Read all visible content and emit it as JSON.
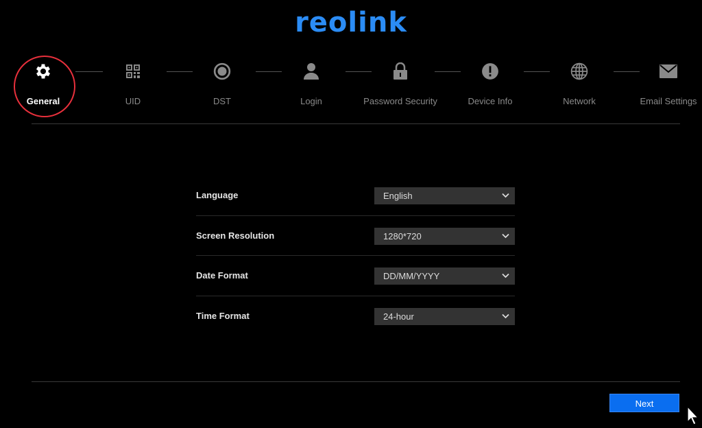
{
  "brand": {
    "logo_text": "reolink",
    "color": "#2b8cf5"
  },
  "steps": [
    {
      "label": "General",
      "icon": "gear-icon",
      "active": true
    },
    {
      "label": "UID",
      "icon": "qr-code-icon",
      "active": false
    },
    {
      "label": "DST",
      "icon": "clock-icon",
      "active": false
    },
    {
      "label": "Login",
      "icon": "user-icon",
      "active": false
    },
    {
      "label": "Password Security",
      "icon": "lock-icon",
      "active": false
    },
    {
      "label": "Device Info",
      "icon": "info-alert-icon",
      "active": false
    },
    {
      "label": "Network",
      "icon": "globe-icon",
      "active": false
    },
    {
      "label": "Email Settings",
      "icon": "envelope-icon",
      "active": false
    }
  ],
  "form": {
    "language": {
      "label": "Language",
      "value": "English"
    },
    "resolution": {
      "label": "Screen Resolution",
      "value": "1280*720"
    },
    "date_format": {
      "label": "Date Format",
      "value": "DD/MM/YYYY"
    },
    "time_format": {
      "label": "Time Format",
      "value": "24-hour"
    }
  },
  "footer": {
    "next_label": "Next"
  },
  "colors": {
    "accent": "#0a6ef0",
    "highlight_ring": "#e8303c",
    "inactive_icon": "#8a8a8a"
  }
}
